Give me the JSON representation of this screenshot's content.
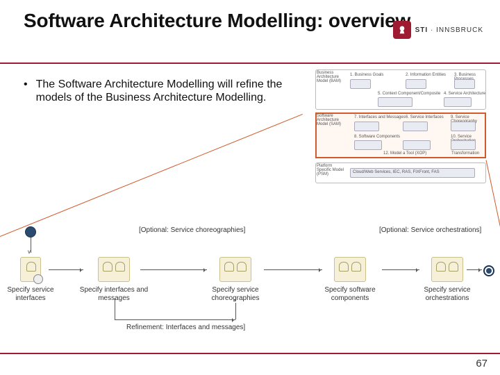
{
  "title": "Software Architecture Modelling: overview",
  "logo": {
    "name": "STI",
    "suffix": "INNSBRUCK"
  },
  "bullet": "The Software Architecture Modelling will refine the models of the Business Architecture Modelling.",
  "right_diagram": {
    "group1_label": "Business Architecture Model (BAM)",
    "group2_label": "Software Architecture Model (SAM)",
    "group3_label": "Platform Specific Model (PSM)",
    "b1": "1. Business Goals",
    "b2": "2. Information Entities",
    "b3": "3. Business Processes",
    "b4": "4. Service Architecture",
    "b5": "5. Context Component/Composite",
    "b6": "6. Service Interfaces",
    "b7": "7. Interfaces and Messages",
    "b8": "8. Software Components",
    "b9": "9. Service Choreography",
    "b10": "10. Service Orchestration",
    "b11": "12. Model a Tool (XOP)",
    "b12": "Transformation",
    "psm": "Cloud/Web Services, IEC, RAS, FIXFront, FAS"
  },
  "workflow": {
    "note_left": "[Optional: Service choreographies]",
    "note_right": "[Optional: Service orchestrations]",
    "note_bottom": "Refinement: Interfaces and messages]",
    "items": [
      {
        "label": "Specify service interfaces"
      },
      {
        "label": "Specify interfaces and messages"
      },
      {
        "label": "Specify service choreographies"
      },
      {
        "label": "Specify software components"
      },
      {
        "label": "Specify service orchestrations"
      }
    ]
  },
  "page": "67"
}
